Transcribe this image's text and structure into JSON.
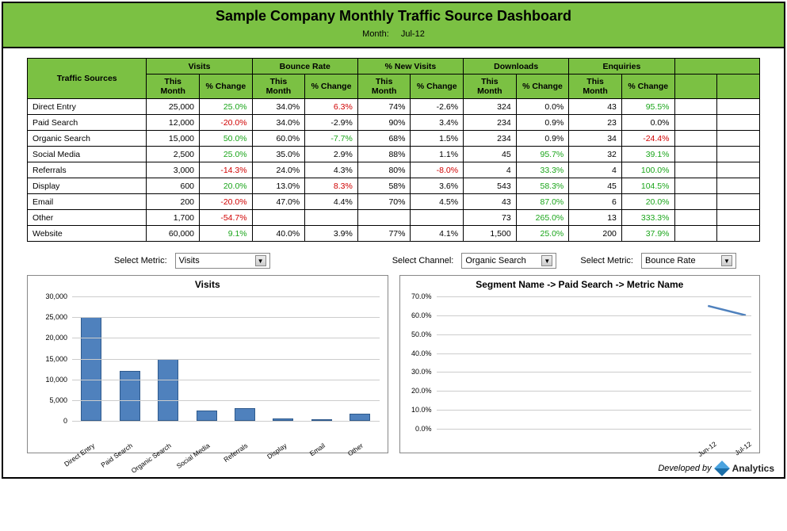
{
  "header": {
    "title": "Sample Company Monthly Traffic Source Dashboard",
    "month_label": "Month:",
    "month_value": "Jul-12"
  },
  "columns": {
    "traffic_sources": "Traffic Sources",
    "groups": [
      "Visits",
      "Bounce Rate",
      "% New Visits",
      "Downloads",
      "Enquiries"
    ],
    "sub": {
      "this_month": "This Month",
      "change": "% Change"
    }
  },
  "rows": [
    {
      "source": "Direct Entry",
      "visits_tm": "25,000",
      "visits_ch": "25.0%",
      "visits_ch_cls": "pos",
      "br_tm": "34.0%",
      "br_ch": "6.3%",
      "br_ch_cls": "neg",
      "nv_tm": "74%",
      "nv_ch": "-2.6%",
      "nv_ch_cls": "",
      "dl_tm": "324",
      "dl_ch": "0.0%",
      "dl_ch_cls": "",
      "enq_tm": "43",
      "enq_ch": "95.5%",
      "enq_ch_cls": "pos"
    },
    {
      "source": "Paid Search",
      "visits_tm": "12,000",
      "visits_ch": "-20.0%",
      "visits_ch_cls": "neg",
      "br_tm": "34.0%",
      "br_ch": "-2.9%",
      "br_ch_cls": "",
      "nv_tm": "90%",
      "nv_ch": "3.4%",
      "nv_ch_cls": "",
      "dl_tm": "234",
      "dl_ch": "0.9%",
      "dl_ch_cls": "",
      "enq_tm": "23",
      "enq_ch": "0.0%",
      "enq_ch_cls": ""
    },
    {
      "source": "Organic Search",
      "visits_tm": "15,000",
      "visits_ch": "50.0%",
      "visits_ch_cls": "pos",
      "br_tm": "60.0%",
      "br_ch": "-7.7%",
      "br_ch_cls": "pos",
      "nv_tm": "68%",
      "nv_ch": "1.5%",
      "nv_ch_cls": "",
      "dl_tm": "234",
      "dl_ch": "0.9%",
      "dl_ch_cls": "",
      "enq_tm": "34",
      "enq_ch": "-24.4%",
      "enq_ch_cls": "neg"
    },
    {
      "source": "Social Media",
      "visits_tm": "2,500",
      "visits_ch": "25.0%",
      "visits_ch_cls": "pos",
      "br_tm": "35.0%",
      "br_ch": "2.9%",
      "br_ch_cls": "",
      "nv_tm": "88%",
      "nv_ch": "1.1%",
      "nv_ch_cls": "",
      "dl_tm": "45",
      "dl_ch": "95.7%",
      "dl_ch_cls": "pos",
      "enq_tm": "32",
      "enq_ch": "39.1%",
      "enq_ch_cls": "pos"
    },
    {
      "source": "Referrals",
      "visits_tm": "3,000",
      "visits_ch": "-14.3%",
      "visits_ch_cls": "neg",
      "br_tm": "24.0%",
      "br_ch": "4.3%",
      "br_ch_cls": "",
      "nv_tm": "80%",
      "nv_ch": "-8.0%",
      "nv_ch_cls": "neg",
      "dl_tm": "4",
      "dl_ch": "33.3%",
      "dl_ch_cls": "pos",
      "enq_tm": "4",
      "enq_ch": "100.0%",
      "enq_ch_cls": "pos"
    },
    {
      "source": "Display",
      "visits_tm": "600",
      "visits_ch": "20.0%",
      "visits_ch_cls": "pos",
      "br_tm": "13.0%",
      "br_ch": "8.3%",
      "br_ch_cls": "neg",
      "nv_tm": "58%",
      "nv_ch": "3.6%",
      "nv_ch_cls": "",
      "dl_tm": "543",
      "dl_ch": "58.3%",
      "dl_ch_cls": "pos",
      "enq_tm": "45",
      "enq_ch": "104.5%",
      "enq_ch_cls": "pos"
    },
    {
      "source": "Email",
      "visits_tm": "200",
      "visits_ch": "-20.0%",
      "visits_ch_cls": "neg",
      "br_tm": "47.0%",
      "br_ch": "4.4%",
      "br_ch_cls": "",
      "nv_tm": "70%",
      "nv_ch": "4.5%",
      "nv_ch_cls": "",
      "dl_tm": "43",
      "dl_ch": "87.0%",
      "dl_ch_cls": "pos",
      "enq_tm": "6",
      "enq_ch": "20.0%",
      "enq_ch_cls": "pos"
    },
    {
      "source": "Other",
      "visits_tm": "1,700",
      "visits_ch": "-54.7%",
      "visits_ch_cls": "neg",
      "br_tm": "",
      "br_ch": "",
      "br_ch_cls": "",
      "nv_tm": "",
      "nv_ch": "",
      "nv_ch_cls": "",
      "dl_tm": "73",
      "dl_ch": "265.0%",
      "dl_ch_cls": "pos",
      "enq_tm": "13",
      "enq_ch": "333.3%",
      "enq_ch_cls": "pos"
    },
    {
      "source": "Website",
      "visits_tm": "60,000",
      "visits_ch": "9.1%",
      "visits_ch_cls": "pos",
      "br_tm": "40.0%",
      "br_ch": "3.9%",
      "br_ch_cls": "",
      "nv_tm": "77%",
      "nv_ch": "4.1%",
      "nv_ch_cls": "",
      "dl_tm": "1,500",
      "dl_ch": "25.0%",
      "dl_ch_cls": "pos",
      "enq_tm": "200",
      "enq_ch": "37.9%",
      "enq_ch_cls": "pos"
    }
  ],
  "controls": {
    "metric_left_label": "Select Metric:",
    "metric_left_value": "Visits",
    "channel_label": "Select Channel:",
    "channel_value": "Organic Search",
    "metric_right_label": "Select Metric:",
    "metric_right_value": "Bounce Rate"
  },
  "chart_data": [
    {
      "type": "bar",
      "title": "Visits",
      "categories": [
        "Direct Entry",
        "Paid Search",
        "Organic Search",
        "Social Media",
        "Referrals",
        "Display",
        "Email",
        "Other"
      ],
      "values": [
        25000,
        12000,
        15000,
        2500,
        3000,
        600,
        200,
        1700
      ],
      "ylabel": "",
      "ylim": [
        0,
        30000
      ],
      "yticks": [
        0,
        5000,
        10000,
        15000,
        20000,
        25000,
        30000
      ],
      "ytick_labels": [
        "0",
        "5,000",
        "10,000",
        "15,000",
        "20,000",
        "25,000",
        "30,000"
      ]
    },
    {
      "type": "line",
      "title": "Segment Name -> Paid Search -> Metric Name",
      "x": [
        "Jun-12",
        "Jul-12"
      ],
      "series": [
        {
          "name": "Bounce Rate",
          "values": [
            0.65,
            0.6
          ]
        }
      ],
      "ylim": [
        0.0,
        0.7
      ],
      "yticks": [
        0.0,
        0.1,
        0.2,
        0.3,
        0.4,
        0.5,
        0.6,
        0.7
      ],
      "ytick_labels": [
        "0.0%",
        "10.0%",
        "20.0%",
        "30.0%",
        "40.0%",
        "50.0%",
        "60.0%",
        "70.0%"
      ]
    }
  ],
  "footer": {
    "developed_by": "Developed by",
    "brand": "Analytics"
  }
}
